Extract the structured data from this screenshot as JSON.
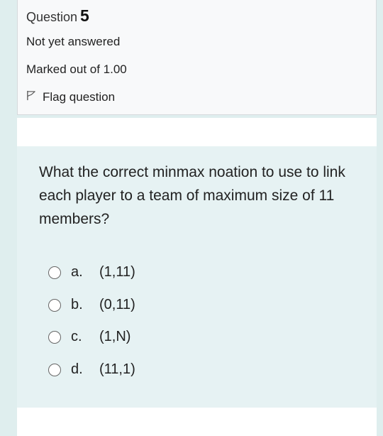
{
  "question": {
    "label": "Question",
    "number": "5",
    "state": "Not yet answered",
    "grade": "Marked out of 1.00",
    "flag_label": "Flag question",
    "text": "What the correct minmax noation to use to link each player to a team of maximum size of 11 members?"
  },
  "answers": [
    {
      "letter": "a.",
      "text": "(1,11)"
    },
    {
      "letter": "b.",
      "text": "(0,11)"
    },
    {
      "letter": "c.",
      "text": "(1,N)"
    },
    {
      "letter": "d.",
      "text": "(11,1)"
    }
  ],
  "icons": {
    "flag": "flag-outline-icon",
    "radio": "radio-unchecked-icon"
  },
  "colors": {
    "background": "#dfeeee",
    "info_box": "#f8f9fa",
    "content_box": "#e6f2f3"
  }
}
